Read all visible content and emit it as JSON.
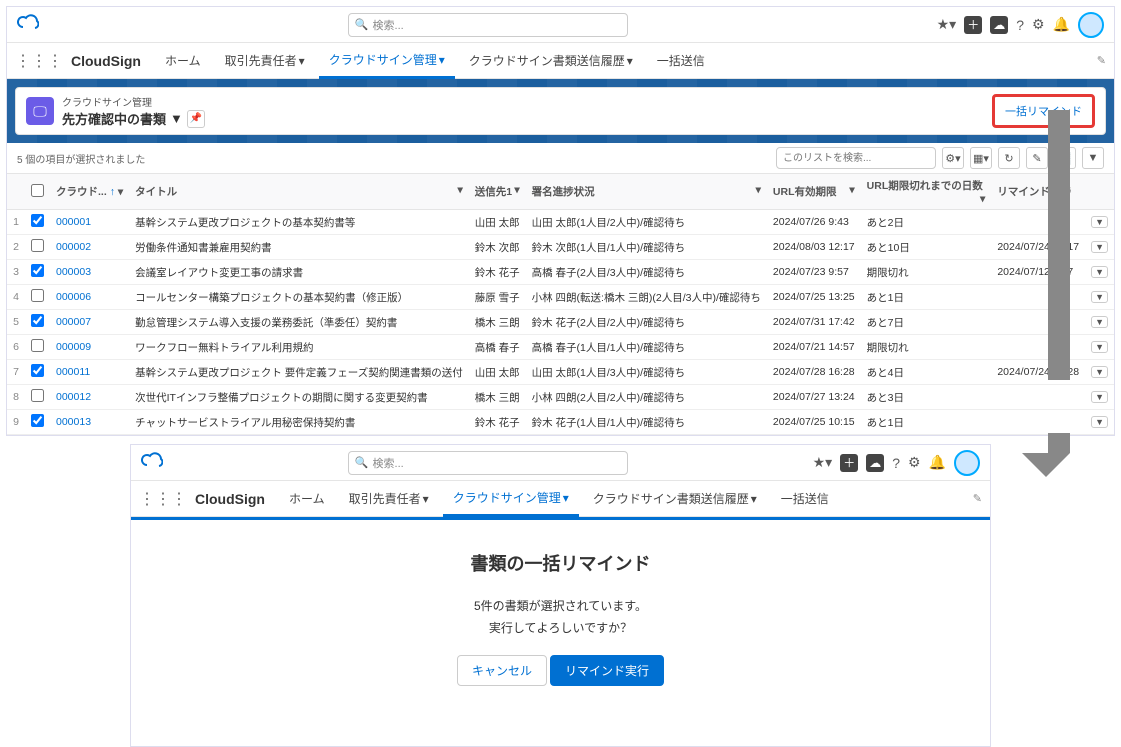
{
  "search_placeholder": "検索...",
  "appname": "CloudSign",
  "tabs": [
    "ホーム",
    "取引先責任者",
    "クラウドサイン管理",
    "クラウドサイン書類送信履歴",
    "一括送信"
  ],
  "header": {
    "small": "クラウドサイン管理",
    "title": "先方確認中の書類"
  },
  "remind_button": "一括リマインド",
  "selection_text": "5 個の項目が選択されました",
  "list_search_placeholder": "このリストを検索...",
  "columns": {
    "cloud": "クラウド...",
    "title": "タイトル",
    "recipient": "送信先1",
    "status": "署名進捗状況",
    "url_expiry": "URL有効期限",
    "days_left": "URL期限切れまでの日数",
    "remind_dt": "リマインド日時"
  },
  "rows": [
    {
      "n": "1",
      "chk": true,
      "id": "000001",
      "title": "基幹システム更改プロジェクトの基本契約書等",
      "to": "山田 太郎",
      "status": "山田 太郎(1人目/2人中)/確認待ち",
      "exp": "2024/07/26 9:43",
      "days": "あと2日",
      "rem": ""
    },
    {
      "n": "2",
      "chk": false,
      "id": "000002",
      "title": "労働条件通知書兼雇用契約書",
      "to": "鈴木 次郎",
      "status": "鈴木 次郎(1人目/1人中)/確認待ち",
      "exp": "2024/08/03 12:17",
      "days": "あと10日",
      "rem": "2024/07/24 12:17"
    },
    {
      "n": "3",
      "chk": true,
      "id": "000003",
      "title": "会議室レイアウト変更工事の請求書",
      "to": "鈴木 花子",
      "status": "高橋 春子(2人目/3人中)/確認待ち",
      "exp": "2024/07/23 9:57",
      "days": "期限切れ",
      "rem": "2024/07/12 9:57"
    },
    {
      "n": "4",
      "chk": false,
      "id": "000006",
      "title": "コールセンター構築プロジェクトの基本契約書（修正版）",
      "to": "藤原 雪子",
      "status": "小林 四朗(転送:橋木 三朗)(2人目/3人中)/確認待ち",
      "exp": "2024/07/25 13:25",
      "days": "あと1日",
      "rem": ""
    },
    {
      "n": "5",
      "chk": true,
      "id": "000007",
      "title": "勤怠管理システム導入支援の業務委託（準委任）契約書",
      "to": "橋木 三朗",
      "status": "鈴木 花子(2人目/2人中)/確認待ち",
      "exp": "2024/07/31 17:42",
      "days": "あと7日",
      "rem": ""
    },
    {
      "n": "6",
      "chk": false,
      "id": "000009",
      "title": "ワークフロー無料トライアル利用規約",
      "to": "高橋 春子",
      "status": "高橋 春子(1人目/1人中)/確認待ち",
      "exp": "2024/07/21 14:57",
      "days": "期限切れ",
      "rem": ""
    },
    {
      "n": "7",
      "chk": true,
      "id": "000011",
      "title": "基幹システム更改プロジェクト 要件定義フェーズ契約関連書類の送付",
      "to": "山田 太郎",
      "status": "山田 太郎(1人目/3人中)/確認待ち",
      "exp": "2024/07/28 16:28",
      "days": "あと4日",
      "rem": "2024/07/24 16:28"
    },
    {
      "n": "8",
      "chk": false,
      "id": "000012",
      "title": "次世代ITインフラ整備プロジェクトの期間に関する変更契約書",
      "to": "橋木 三朗",
      "status": "小林 四朗(2人目/2人中)/確認待ち",
      "exp": "2024/07/27 13:24",
      "days": "あと3日",
      "rem": ""
    },
    {
      "n": "9",
      "chk": true,
      "id": "000013",
      "title": "チャットサービストライアル用秘密保持契約書",
      "to": "鈴木 花子",
      "status": "鈴木 花子(1人目/1人中)/確認待ち",
      "exp": "2024/07/25 10:15",
      "days": "あと1日",
      "rem": ""
    }
  ],
  "confirm": {
    "title": "書類の一括リマインド",
    "line1": "5件の書類が選択されています。",
    "line2": "実行してよろしいですか？",
    "cancel": "キャンセル",
    "execute": "リマインド実行"
  }
}
